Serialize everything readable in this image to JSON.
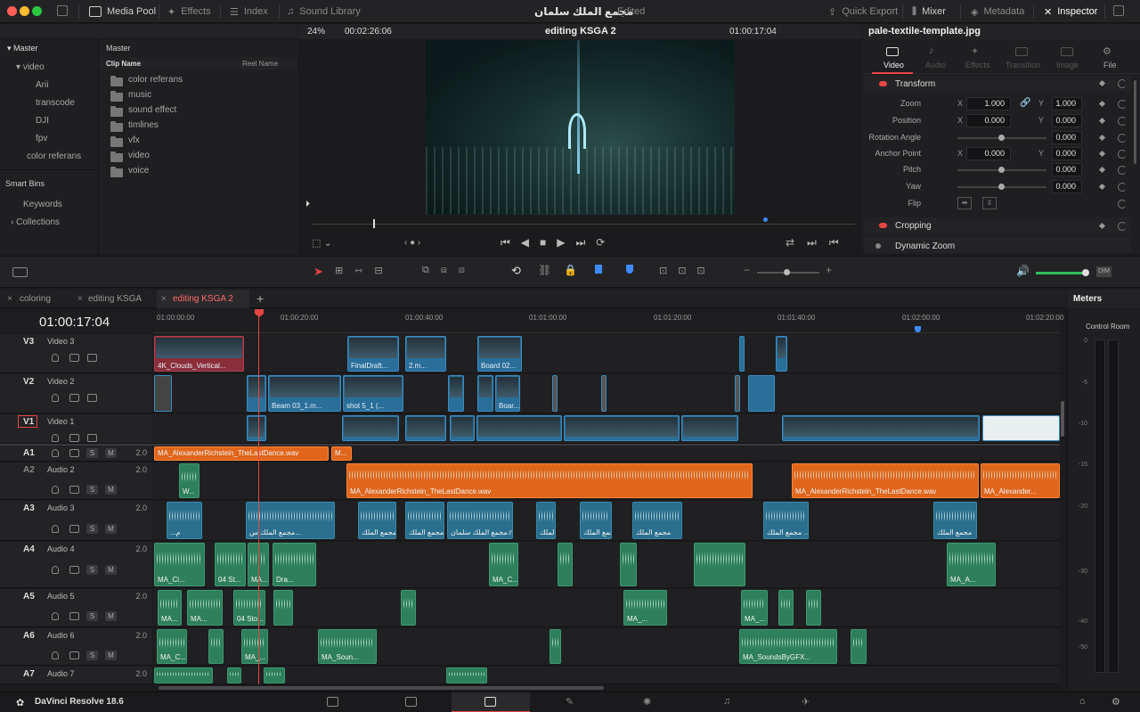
{
  "app": {
    "name": "DaVinci Resolve 18.6",
    "project_title": "مجمع الملك سلمان",
    "project_status": "Edited"
  },
  "toolbar": {
    "media_pool": "Media Pool",
    "effects": "Effects",
    "index": "Index",
    "sound_library": "Sound Library",
    "quick_export": "Quick Export",
    "mixer": "Mixer",
    "metadata": "Metadata",
    "inspector": "Inspector"
  },
  "media_pool": {
    "tree_header": "Master",
    "tree": [
      "video",
      "Arii",
      "transcode",
      "DJI",
      "fpv",
      "color referans"
    ],
    "smart_bins": "Smart Bins",
    "smart_items": [
      "Keywords",
      "Collections"
    ],
    "bin_header": "Master",
    "col_clip_name": "Clip Name",
    "col_reel_name": "Reel Name",
    "folders": [
      "color referans",
      "music",
      "sound effect",
      "timlines",
      "vfx",
      "video",
      "voice"
    ]
  },
  "viewer": {
    "zoom": "24%",
    "duration": "00:02:26:06",
    "timeline_name": "editing KSGA 2",
    "timecode": "01:00:17:04"
  },
  "inspector": {
    "clip_name": "pale-textile-template.jpg",
    "tabs": [
      "Video",
      "Audio",
      "Effects",
      "Transition",
      "Image",
      "File"
    ],
    "transform": "Transform",
    "zoom_label": "Zoom",
    "zoom_x": "1.000",
    "zoom_y": "1.000",
    "position_label": "Position",
    "position_x": "0.000",
    "position_y": "0.000",
    "rotation_label": "Rotation Angle",
    "rotation": "0.000",
    "anchor_label": "Anchor Point",
    "anchor_x": "0.000",
    "anchor_y": "0.000",
    "pitch_label": "Pitch",
    "pitch": "0.000",
    "yaw_label": "Yaw",
    "yaw": "0.000",
    "flip_label": "Flip",
    "x": "X",
    "y": "Y",
    "cropping": "Cropping",
    "dynamic_zoom": "Dynamic Zoom"
  },
  "timeline": {
    "tabs": [
      "coloring",
      "editing KSGA",
      "editing KSGA 2"
    ],
    "timecode": "01:00:17:04",
    "ruler": [
      "01:00:00:00",
      "01:00:20:00",
      "01:00:40:00",
      "01:01:00:00",
      "01:01:20:00",
      "01:01:40:00",
      "01:02:00:00",
      "01:02:20:00"
    ],
    "tracks": [
      {
        "id": "V3",
        "name": "Video 3",
        "level": ""
      },
      {
        "id": "V2",
        "name": "Video 2",
        "level": ""
      },
      {
        "id": "V1",
        "name": "Video 1",
        "level": ""
      },
      {
        "id": "A1",
        "name": "",
        "level": "2.0"
      },
      {
        "id": "A2",
        "name": "Audio 2",
        "level": "2.0"
      },
      {
        "id": "A3",
        "name": "Audio 3",
        "level": "2.0"
      },
      {
        "id": "A4",
        "name": "Audio 4",
        "level": "2.0"
      },
      {
        "id": "A5",
        "name": "Audio 5",
        "level": "2.0"
      },
      {
        "id": "A6",
        "name": "Audio 6",
        "level": "2.0"
      },
      {
        "id": "A7",
        "name": "Audio 7",
        "level": "2.0"
      }
    ],
    "clips": {
      "v3_a": "4K_Clouds_Vertical...",
      "v3_b": "FinalDraft...",
      "v3_c": "2.m...",
      "v3_d": "Board 02...",
      "v2_a": "Beam 03_1.m...",
      "v2_b": "shot 5_1 (...",
      "v2_c": "Boar...",
      "a1_a": "MA_AlexanderRichstein_TheLastDance.wav",
      "a1_b": "M...",
      "a2_a": "W...",
      "a2_b": "MA_AlexanderRichstein_TheLastDance.wav",
      "a2_c": "MA_AlexanderRichstein_TheLastDance.wav",
      "a2_d": "MA_Alexander...",
      "a3_a": "...م",
      "a3_b": "مجمع الملك س...",
      "a3_c": "مجمع الملك",
      "a3_d": "مجمع الملك",
      "a3_e": "مجمع الملك سلمان.m...",
      "a3_f": "مجمع الملك",
      "a3_g": "مجمع الملك",
      "a3_h": "مجمع الملك",
      "a3_i": "مجمع الملك ...",
      "a3_j": "مجمع الملك",
      "a4_a": "MA_Ci...",
      "a4_b": "04 St...",
      "a4_c": "MA...",
      "a4_d": "Dra...",
      "a4_e": "MA_C...",
      "a4_f": "MA_A...",
      "a5_a": "MA...",
      "a5_b": "MA...",
      "a5_c": "04 Sto...",
      "a5_d": "MA_...",
      "a5_e": "MA_...",
      "a6_a": "MA_C...",
      "a6_b": "MA_...",
      "a6_c": "MA_Soun...",
      "a6_d": "MA_SoundsByGFX..."
    }
  },
  "meters": {
    "title": "Meters",
    "room": "Control Room",
    "scale": [
      "0",
      "-5",
      "-10",
      "-15",
      "-20",
      "-30",
      "-40",
      "-50"
    ]
  }
}
